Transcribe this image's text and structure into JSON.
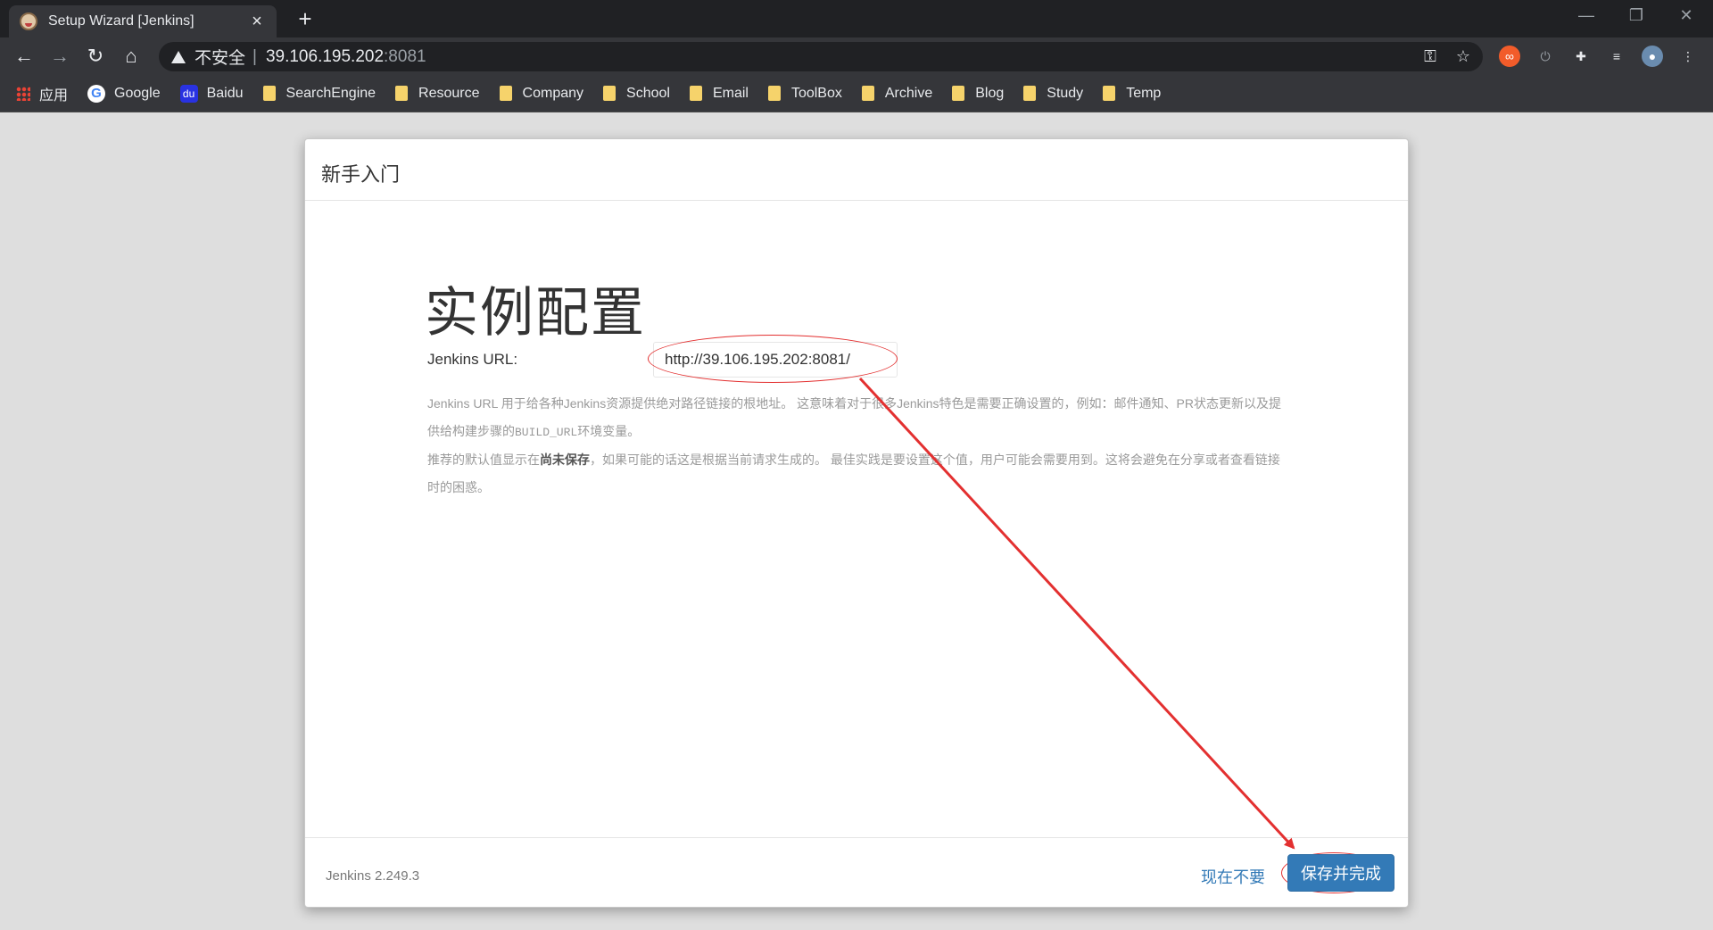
{
  "browser": {
    "tab": {
      "title": "Setup Wizard [Jenkins]"
    },
    "address": {
      "security_label": "不安全",
      "separator": "|",
      "host": "39.106.195.202",
      "port": ":8081"
    },
    "bookmarks": [
      {
        "label": "应用",
        "icon": "apps-icon"
      },
      {
        "label": "Google",
        "icon": "google-icon"
      },
      {
        "label": "Baidu",
        "icon": "baidu-icon"
      },
      {
        "label": "SearchEngine",
        "icon": "folder-icon"
      },
      {
        "label": "Resource",
        "icon": "folder-icon"
      },
      {
        "label": "Company",
        "icon": "folder-icon"
      },
      {
        "label": "School",
        "icon": "folder-icon"
      },
      {
        "label": "Email",
        "icon": "folder-icon"
      },
      {
        "label": "ToolBox",
        "icon": "folder-icon"
      },
      {
        "label": "Archive",
        "icon": "folder-icon"
      },
      {
        "label": "Blog",
        "icon": "folder-icon"
      },
      {
        "label": "Study",
        "icon": "folder-icon"
      },
      {
        "label": "Temp",
        "icon": "folder-icon"
      }
    ]
  },
  "wizard": {
    "header": "新手入门",
    "title": "实例配置",
    "url_label": "Jenkins URL:",
    "url_value": "http://39.106.195.202:8081/",
    "help": {
      "p1_a": "Jenkins URL 用于给各种Jenkins资源提供绝对路径链接的根地址。 这意味着对于很多Jenkins特色是需要正确设置的，例如：邮件通知、PR状态更新以及提供给构建步骤的",
      "p1_code": "BUILD_URL",
      "p1_b": "环境变量。",
      "p2_a": "推荐的默认值显示在",
      "p2_strong": "尚未保存",
      "p2_b": "，如果可能的话这是根据当前请求生成的。 最佳实践是要设置这个值，用户可能会需要用到。这将会避免在分享或者查看链接时的困惑。"
    },
    "footer": {
      "version": "Jenkins 2.249.3",
      "skip": "现在不要",
      "save": "保存并完成"
    }
  },
  "annotation_color": "#e33030",
  "accent_color": "#337ab7"
}
